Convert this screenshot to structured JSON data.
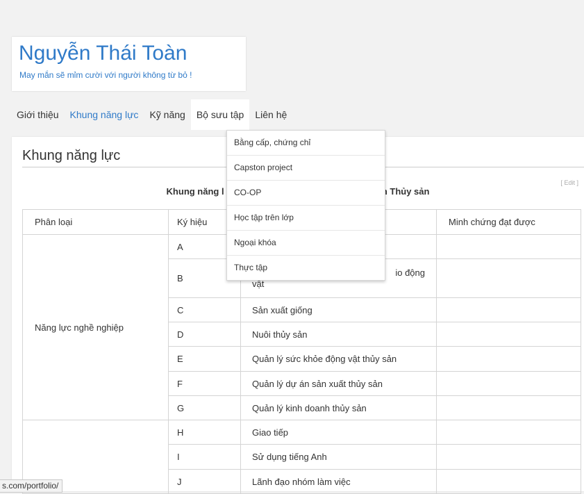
{
  "header": {
    "title": "Nguyễn Thái Toàn",
    "tagline": "May mắn sẽ mỉm cười với người không từ bỏ !"
  },
  "nav": {
    "items": [
      {
        "label": "Giới thiệu"
      },
      {
        "label": "Khung năng lực"
      },
      {
        "label": "Kỹ năng"
      },
      {
        "label": "Bộ sưu tập"
      },
      {
        "label": "Liên hệ"
      }
    ],
    "active_item": "Khung năng lực",
    "open_menu": "Bộ sưu tập"
  },
  "dropdown": {
    "items": [
      {
        "label": "Bằng cấp, chứng chỉ"
      },
      {
        "label": "Capston project"
      },
      {
        "label": "CO-OP"
      },
      {
        "label": "Học tập trên lớp"
      },
      {
        "label": "Ngoại khóa"
      },
      {
        "label": "Thực tập"
      }
    ]
  },
  "main": {
    "page_title": "Khung năng lực",
    "edit_link": "[ Edit ]",
    "caption_left": "Khung năng l",
    "caption_right": "ân Thủy sản",
    "table": {
      "headers": [
        "Phân loại",
        "Ký hiệu",
        "",
        "Minh chứng đạt được"
      ],
      "group1_label": "Năng lực nghề nghiệp",
      "rows": [
        {
          "code": "A",
          "desc": ""
        },
        {
          "code": "B",
          "desc": "io động",
          "desc2": "vật"
        },
        {
          "code": "C",
          "desc": "Sản xuất giống"
        },
        {
          "code": "D",
          "desc": "Nuôi thủy sản"
        },
        {
          "code": "E",
          "desc": "Quản lý sức khỏe động vật thủy sản"
        },
        {
          "code": "F",
          "desc": "Quản lý dự án sản xuất thủy sản"
        },
        {
          "code": "G",
          "desc": "Quản lý kinh doanh thủy sản"
        },
        {
          "code": "H",
          "desc": "Giao tiếp"
        },
        {
          "code": "I",
          "desc": "Sử dụng tiếng Anh"
        },
        {
          "code": "J",
          "desc": "Lãnh đạo nhóm làm việc"
        }
      ]
    }
  },
  "status_bar": {
    "url": "s.com/portfolio/"
  },
  "colors": {
    "accent": "#2f7ac8",
    "page_bg": "#f2f2f2"
  }
}
